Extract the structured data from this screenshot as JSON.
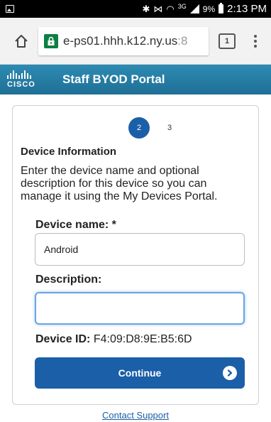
{
  "status_bar": {
    "network": "3G",
    "battery": "9%",
    "time": "2:13 PM"
  },
  "browser": {
    "url_main": "e-ps01.hhh.k12.ny.us",
    "url_faded": ":8",
    "tab_count": "1"
  },
  "header": {
    "logo_text": "CISCO",
    "title": "Staff BYOD Portal"
  },
  "steps": {
    "current": "2",
    "next": "3"
  },
  "form": {
    "section_title": "Device Information",
    "instructions": "Enter the device name and optional description for this device so you can manage it using the My Devices Portal.",
    "device_name_label": "Device name: *",
    "device_name_value": "Android",
    "description_label": "Description:",
    "description_value": "",
    "device_id_label": "Device ID:",
    "device_id_value": "F4:09:D8:9E:B5:6D",
    "continue_label": "Continue"
  },
  "footer": {
    "contact_label": "Contact Support"
  },
  "colors": {
    "primary_blue": "#1b5fa8",
    "header_blue": "#2d8bb3",
    "secure_green": "#0b8043"
  }
}
